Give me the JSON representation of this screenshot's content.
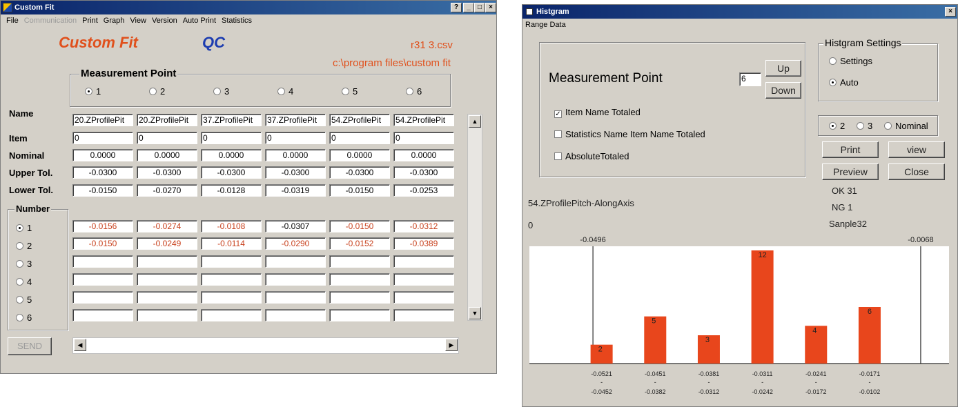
{
  "left_window": {
    "title": "Custom Fit",
    "title_buttons": [
      "?",
      "_",
      "□",
      "×"
    ],
    "menu": [
      "File",
      "Communication",
      "Print",
      "Graph",
      "View",
      "Version",
      "Auto Print",
      "Statistics"
    ],
    "app_name": "Custom Fit",
    "qc_label": "QC",
    "file_name": "r31  3.csv",
    "file_path": "c:\\program files\\custom fit",
    "measurement_point": {
      "label": "Measurement Point",
      "options": [
        "1",
        "2",
        "3",
        "4",
        "5",
        "6"
      ],
      "selected": "1"
    },
    "row_labels": {
      "name": "Name",
      "item": "Item",
      "nominal": "Nominal",
      "upper": "Upper Tol.",
      "lower": "Lower Tol."
    },
    "columns": [
      {
        "name": "20.ZProfilePit",
        "item": "0",
        "nominal": "0.0000",
        "upper": "-0.0300",
        "lower": "-0.0150",
        "v1": "-0.0156",
        "v2": "-0.0150"
      },
      {
        "name": "20.ZProfilePit",
        "item": "0",
        "nominal": "0.0000",
        "upper": "-0.0300",
        "lower": "-0.0270",
        "v1": "-0.0274",
        "v2": "-0.0249"
      },
      {
        "name": "37.ZProfilePit",
        "item": "0",
        "nominal": "0.0000",
        "upper": "-0.0300",
        "lower": "-0.0128",
        "v1": "-0.0108",
        "v2": "-0.0114"
      },
      {
        "name": "37.ZProfilePit",
        "item": "0",
        "nominal": "0.0000",
        "upper": "-0.0300",
        "lower": "-0.0319",
        "v1": "-0.0307",
        "v2": "-0.0290"
      },
      {
        "name": "54.ZProfilePit",
        "item": "0",
        "nominal": "0.0000",
        "upper": "-0.0300",
        "lower": "-0.0150",
        "v1": "-0.0150",
        "v2": "-0.0152"
      },
      {
        "name": "54.ZProfilePit",
        "item": "0",
        "nominal": "0.0000",
        "upper": "-0.0300",
        "lower": "-0.0253",
        "v1": "-0.0312",
        "v2": "-0.0389"
      }
    ],
    "number": {
      "label": "Number",
      "options": [
        "1",
        "2",
        "3",
        "4",
        "5",
        "6"
      ],
      "selected": "1"
    },
    "send_label": "SEND",
    "colors": {
      "title_red": "#e0501c",
      "qc_blue": "#1c3cb0",
      "value_red": "#c8401c"
    }
  },
  "right_window": {
    "title": "Histgram",
    "menu": [
      "Range Data"
    ],
    "measurement_point_label": "Measurement Point",
    "point_value": "6",
    "up_label": "Up",
    "down_label": "Down",
    "checks": [
      {
        "label": "Item Name Totaled",
        "checked": true
      },
      {
        "label": "Statistics Name Item Name Totaled",
        "checked": false
      },
      {
        "label": "AbsoluteTotaled",
        "checked": false
      }
    ],
    "settings": {
      "label": "Histgram Settings",
      "options": [
        "Settings",
        "Auto"
      ],
      "selected": "Auto"
    },
    "mode": {
      "options": [
        "2",
        "3",
        "Nominal"
      ],
      "selected": "2"
    },
    "buttons": {
      "print": "Print",
      "view": "view",
      "preview": "Preview",
      "close": "Close"
    },
    "ok": "OK 31",
    "ng": "NG 1",
    "sample": "Sanple32",
    "item_name": "54.ZProfilePitch-AlongAxis",
    "item_value": "0"
  },
  "chart_data": {
    "type": "bar",
    "categories": [
      "-0.0521 - -0.0452",
      "-0.0451 - -0.0382",
      "-0.0381 - -0.0312",
      "-0.0311 - -0.0242",
      "-0.0241 - -0.0172",
      "-0.0171 - -0.0102"
    ],
    "bins": [
      {
        "from": "-0.0521",
        "to": "-0.0452"
      },
      {
        "from": "-0.0451",
        "to": "-0.0382"
      },
      {
        "from": "-0.0381",
        "to": "-0.0312"
      },
      {
        "from": "-0.0311",
        "to": "-0.0242"
      },
      {
        "from": "-0.0241",
        "to": "-0.0172"
      },
      {
        "from": "-0.0171",
        "to": "-0.0102"
      }
    ],
    "values": [
      2,
      5,
      3,
      12,
      4,
      6
    ],
    "limits": [
      {
        "label": "-0.0496",
        "value": -0.0496
      },
      {
        "label": "-0.0068",
        "value": -0.0068
      }
    ],
    "x_range": [
      -0.0579,
      -0.0031
    ],
    "ylim": [
      0,
      12
    ],
    "bar_color": "#e8461c",
    "grid": false
  }
}
